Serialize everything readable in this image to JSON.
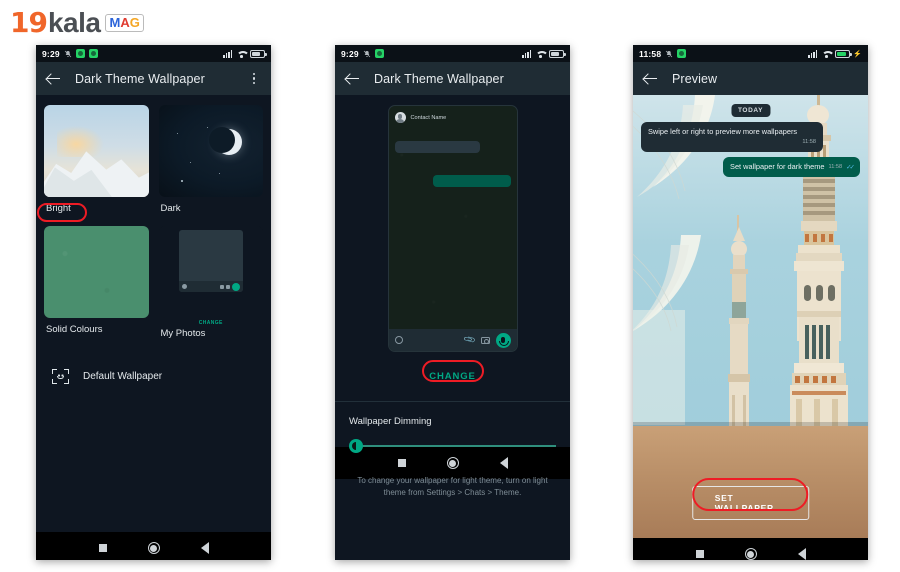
{
  "logo": {
    "part1": "19",
    "part2": "kala",
    "mag": [
      "M",
      "A",
      "G"
    ]
  },
  "colors": {
    "accent_teal": "#00a884",
    "bubble_out": "#005c4b",
    "appbar": "#1f2c34",
    "highlight_red": "#ee1c25",
    "body_bg": "#0e1621"
  },
  "phones": [
    {
      "status": {
        "time": "9:29",
        "mute_icon": "mute-icon",
        "badges": 2,
        "signal_icon": "signal-icon",
        "wifi_icon": "wifi-icon",
        "battery_icon": "battery-icon"
      },
      "appbar": {
        "back_icon": "back-arrow-icon",
        "title": "Dark Theme Wallpaper",
        "menu_icon": "overflow-menu-icon"
      },
      "wallpaper_options": [
        {
          "label": "Bright",
          "thumb": "mountain-sunrise-thumb",
          "highlighted": true
        },
        {
          "label": "Dark",
          "thumb": "crescent-moon-night-thumb",
          "highlighted": false
        },
        {
          "label": "Solid Colours",
          "thumb": "green-solid-thumb",
          "highlighted": false
        },
        {
          "label": "My Photos",
          "thumb": "chat-preview-thumb",
          "highlighted": false
        }
      ],
      "my_photos_change": "CHANGE",
      "default_row": {
        "icon": "wallpaper-image-icon",
        "label": "Default Wallpaper"
      },
      "nav": {
        "recents": "recents-square-icon",
        "home": "home-circle-icon",
        "back": "back-triangle-icon"
      }
    },
    {
      "status": {
        "time": "9:29",
        "mute_icon": "mute-icon",
        "badges": 1,
        "signal_icon": "signal-icon",
        "wifi_icon": "wifi-icon",
        "battery_icon": "battery-icon"
      },
      "appbar": {
        "back_icon": "back-arrow-icon",
        "title": "Dark Theme Wallpaper"
      },
      "chat_preview": {
        "contact_name": "Contact Name",
        "avatar": "contact-avatar-icon",
        "input_bar": {
          "emoji": "emoji-icon",
          "attach": "attach-clip-icon",
          "camera": "camera-icon",
          "mic": "mic-button"
        }
      },
      "change_button": "CHANGE",
      "dimming": {
        "title": "Wallpaper Dimming",
        "value_percent": 0
      },
      "hint": "To change your wallpaper for light theme, turn on light theme from Settings > Chats > Theme.",
      "nav": {
        "recents": "recents-square-icon",
        "home": "home-circle-icon",
        "back": "back-triangle-icon"
      }
    },
    {
      "status": {
        "time": "11:58",
        "mute_icon": "mute-icon",
        "badges": 1,
        "signal_icon": "signal-icon",
        "wifi_icon": "wifi-icon",
        "battery_icon": "battery-charging-icon"
      },
      "appbar": {
        "back_icon": "back-arrow-icon",
        "title": "Preview"
      },
      "chat": {
        "day_divider": "TODAY",
        "messages": [
          {
            "direction": "incoming",
            "text": "Swipe left or right to preview more wallpapers",
            "time": "11:58"
          },
          {
            "direction": "outgoing",
            "text": "Set wallpaper for dark theme",
            "time": "11:58",
            "status_icon": "double-check-icon"
          }
        ]
      },
      "set_wallpaper_button": "SET WALLPAPER",
      "nav": {
        "recents": "recents-square-icon",
        "home": "home-circle-icon",
        "back": "back-triangle-icon"
      }
    }
  ]
}
